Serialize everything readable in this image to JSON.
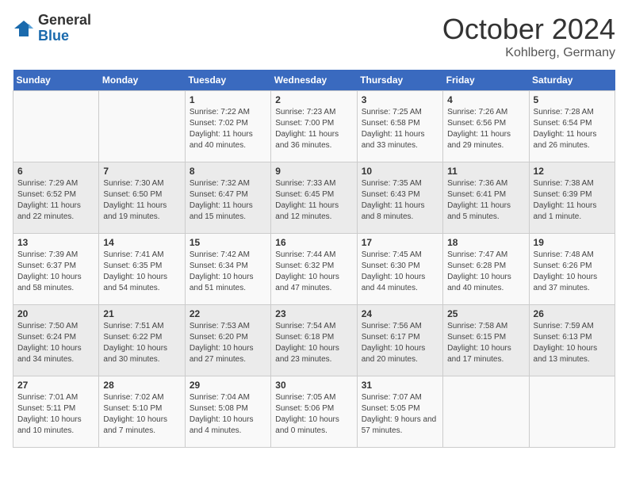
{
  "header": {
    "logo_general": "General",
    "logo_blue": "Blue",
    "month_title": "October 2024",
    "location": "Kohlberg, Germany"
  },
  "weekdays": [
    "Sunday",
    "Monday",
    "Tuesday",
    "Wednesday",
    "Thursday",
    "Friday",
    "Saturday"
  ],
  "weeks": [
    [
      {
        "day": "",
        "info": ""
      },
      {
        "day": "",
        "info": ""
      },
      {
        "day": "1",
        "info": "Sunrise: 7:22 AM\nSunset: 7:02 PM\nDaylight: 11 hours and 40 minutes."
      },
      {
        "day": "2",
        "info": "Sunrise: 7:23 AM\nSunset: 7:00 PM\nDaylight: 11 hours and 36 minutes."
      },
      {
        "day": "3",
        "info": "Sunrise: 7:25 AM\nSunset: 6:58 PM\nDaylight: 11 hours and 33 minutes."
      },
      {
        "day": "4",
        "info": "Sunrise: 7:26 AM\nSunset: 6:56 PM\nDaylight: 11 hours and 29 minutes."
      },
      {
        "day": "5",
        "info": "Sunrise: 7:28 AM\nSunset: 6:54 PM\nDaylight: 11 hours and 26 minutes."
      }
    ],
    [
      {
        "day": "6",
        "info": "Sunrise: 7:29 AM\nSunset: 6:52 PM\nDaylight: 11 hours and 22 minutes."
      },
      {
        "day": "7",
        "info": "Sunrise: 7:30 AM\nSunset: 6:50 PM\nDaylight: 11 hours and 19 minutes."
      },
      {
        "day": "8",
        "info": "Sunrise: 7:32 AM\nSunset: 6:47 PM\nDaylight: 11 hours and 15 minutes."
      },
      {
        "day": "9",
        "info": "Sunrise: 7:33 AM\nSunset: 6:45 PM\nDaylight: 11 hours and 12 minutes."
      },
      {
        "day": "10",
        "info": "Sunrise: 7:35 AM\nSunset: 6:43 PM\nDaylight: 11 hours and 8 minutes."
      },
      {
        "day": "11",
        "info": "Sunrise: 7:36 AM\nSunset: 6:41 PM\nDaylight: 11 hours and 5 minutes."
      },
      {
        "day": "12",
        "info": "Sunrise: 7:38 AM\nSunset: 6:39 PM\nDaylight: 11 hours and 1 minute."
      }
    ],
    [
      {
        "day": "13",
        "info": "Sunrise: 7:39 AM\nSunset: 6:37 PM\nDaylight: 10 hours and 58 minutes."
      },
      {
        "day": "14",
        "info": "Sunrise: 7:41 AM\nSunset: 6:35 PM\nDaylight: 10 hours and 54 minutes."
      },
      {
        "day": "15",
        "info": "Sunrise: 7:42 AM\nSunset: 6:34 PM\nDaylight: 10 hours and 51 minutes."
      },
      {
        "day": "16",
        "info": "Sunrise: 7:44 AM\nSunset: 6:32 PM\nDaylight: 10 hours and 47 minutes."
      },
      {
        "day": "17",
        "info": "Sunrise: 7:45 AM\nSunset: 6:30 PM\nDaylight: 10 hours and 44 minutes."
      },
      {
        "day": "18",
        "info": "Sunrise: 7:47 AM\nSunset: 6:28 PM\nDaylight: 10 hours and 40 minutes."
      },
      {
        "day": "19",
        "info": "Sunrise: 7:48 AM\nSunset: 6:26 PM\nDaylight: 10 hours and 37 minutes."
      }
    ],
    [
      {
        "day": "20",
        "info": "Sunrise: 7:50 AM\nSunset: 6:24 PM\nDaylight: 10 hours and 34 minutes."
      },
      {
        "day": "21",
        "info": "Sunrise: 7:51 AM\nSunset: 6:22 PM\nDaylight: 10 hours and 30 minutes."
      },
      {
        "day": "22",
        "info": "Sunrise: 7:53 AM\nSunset: 6:20 PM\nDaylight: 10 hours and 27 minutes."
      },
      {
        "day": "23",
        "info": "Sunrise: 7:54 AM\nSunset: 6:18 PM\nDaylight: 10 hours and 23 minutes."
      },
      {
        "day": "24",
        "info": "Sunrise: 7:56 AM\nSunset: 6:17 PM\nDaylight: 10 hours and 20 minutes."
      },
      {
        "day": "25",
        "info": "Sunrise: 7:58 AM\nSunset: 6:15 PM\nDaylight: 10 hours and 17 minutes."
      },
      {
        "day": "26",
        "info": "Sunrise: 7:59 AM\nSunset: 6:13 PM\nDaylight: 10 hours and 13 minutes."
      }
    ],
    [
      {
        "day": "27",
        "info": "Sunrise: 7:01 AM\nSunset: 5:11 PM\nDaylight: 10 hours and 10 minutes."
      },
      {
        "day": "28",
        "info": "Sunrise: 7:02 AM\nSunset: 5:10 PM\nDaylight: 10 hours and 7 minutes."
      },
      {
        "day": "29",
        "info": "Sunrise: 7:04 AM\nSunset: 5:08 PM\nDaylight: 10 hours and 4 minutes."
      },
      {
        "day": "30",
        "info": "Sunrise: 7:05 AM\nSunset: 5:06 PM\nDaylight: 10 hours and 0 minutes."
      },
      {
        "day": "31",
        "info": "Sunrise: 7:07 AM\nSunset: 5:05 PM\nDaylight: 9 hours and 57 minutes."
      },
      {
        "day": "",
        "info": ""
      },
      {
        "day": "",
        "info": ""
      }
    ]
  ]
}
